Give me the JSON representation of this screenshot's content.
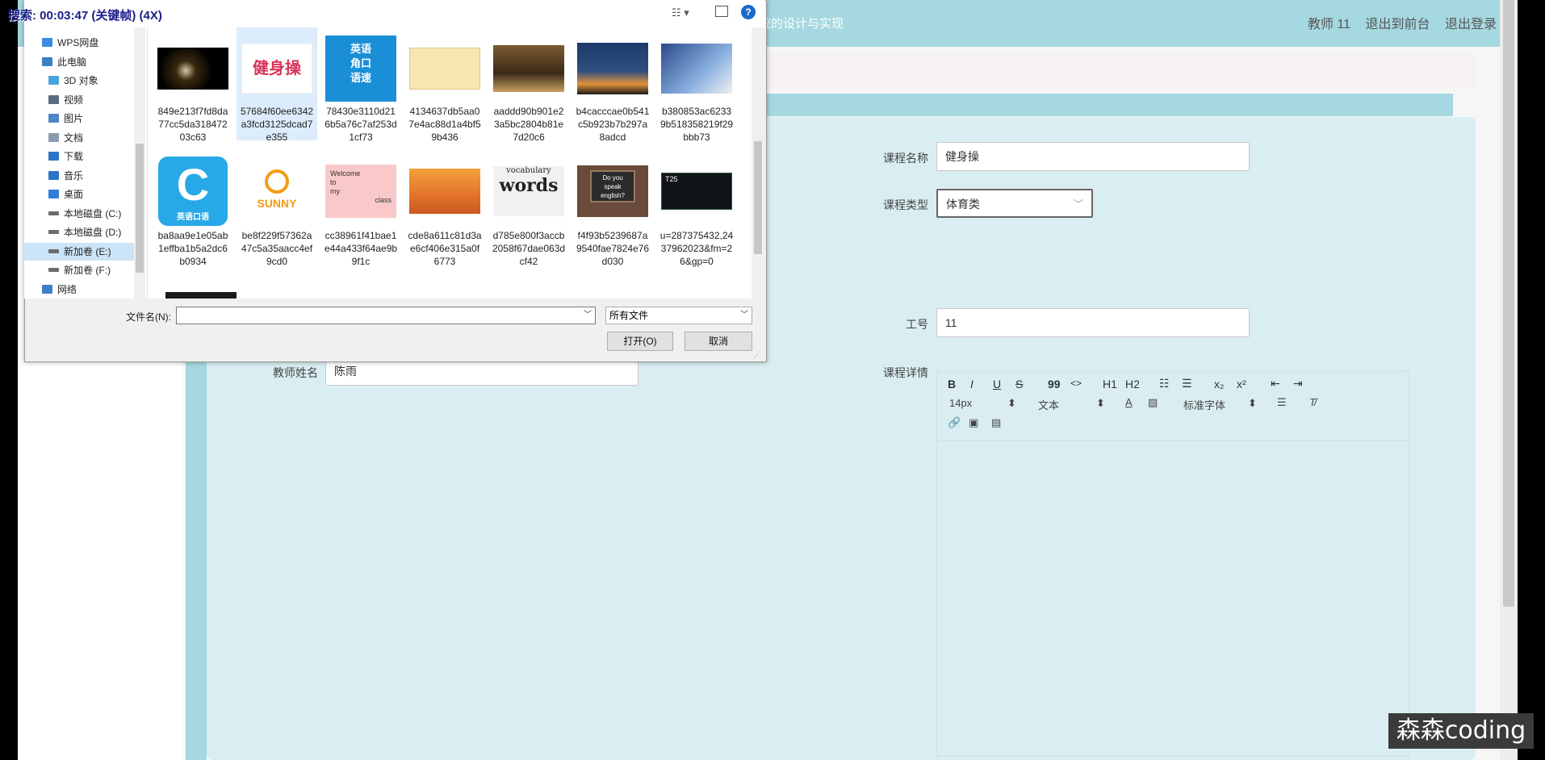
{
  "dialog": {
    "caption": "搜索: 00:03:47 (关键帧) (4X)",
    "tree": [
      {
        "label": "WPS网盘",
        "icon": "cloud-icon",
        "indent": 0
      },
      {
        "label": "此电脑",
        "icon": "computer-icon",
        "indent": 0
      },
      {
        "label": "3D 对象",
        "icon": "cube-icon",
        "indent": 1
      },
      {
        "label": "视频",
        "icon": "video-icon",
        "indent": 1
      },
      {
        "label": "图片",
        "icon": "picture-icon",
        "indent": 1
      },
      {
        "label": "文档",
        "icon": "document-icon",
        "indent": 1
      },
      {
        "label": "下载",
        "icon": "download-icon",
        "indent": 1
      },
      {
        "label": "音乐",
        "icon": "music-icon",
        "indent": 1
      },
      {
        "label": "桌面",
        "icon": "desktop-icon",
        "indent": 1
      },
      {
        "label": "本地磁盘 (C:)",
        "icon": "drive-icon",
        "indent": 1
      },
      {
        "label": "本地磁盘 (D:)",
        "icon": "drive-icon",
        "indent": 1
      },
      {
        "label": "新加卷 (E:)",
        "icon": "drive-icon",
        "indent": 1,
        "selected": true
      },
      {
        "label": "新加卷 (F:)",
        "icon": "drive-icon",
        "indent": 1
      },
      {
        "label": "网络",
        "icon": "network-icon",
        "indent": 0
      }
    ],
    "files": [
      {
        "name": "849e213f7fd8da77cc5da31847203c63",
        "thumb": "dark-dancer"
      },
      {
        "name": "57684f60ee6342a3fcd3125dcad7e355",
        "thumb": "fitness-logo",
        "selected": true
      },
      {
        "name": "78430e3110d216b5a76c7af253d1cf73",
        "thumb": "english-corner"
      },
      {
        "name": "4134637db5aa07e4ac88d1a4bf59b436",
        "thumb": "text-card"
      },
      {
        "name": "aaddd90b901e23a5bc2804b81e7d20c6",
        "thumb": "crowd-photo"
      },
      {
        "name": "b4cacccae0b541c5b923b7b297a8adcd",
        "thumb": "sunset-photo"
      },
      {
        "name": "b380853ac62339b518358219f29bbb73",
        "thumb": "business-photo"
      },
      {
        "name": "ba8aa9e1e05ab1effba1b5a2dc6b0934",
        "thumb": "english-app-logo"
      },
      {
        "name": "be8f229f57362a47c5a35aacc4ef9cd0",
        "thumb": "sunny-logo"
      },
      {
        "name": "cc38961f41bae1e44a433f64ae9b9f1c",
        "thumb": "welcome-card"
      },
      {
        "name": "cde8a611c81d3ae6cf406e315a0f6773",
        "thumb": "jump-photo"
      },
      {
        "name": "d785e800f3accb2058f67dae063dcf42",
        "thumb": "vocabulary-words"
      },
      {
        "name": "f4f93b5239687a9540fae7824e76d030",
        "thumb": "speak-english"
      },
      {
        "name": "u=287375432,2437962023&fm=26&gp=0",
        "thumb": "t25-screen"
      }
    ],
    "thumb_text": {
      "fitness": "健身操",
      "english_corner_1": "英语",
      "english_corner_2": "角口",
      "english_corner_3": "语速",
      "english_app": "英语口语",
      "sunny": "SUNNY",
      "welcome_1": "Welcome",
      "welcome_2": "to",
      "welcome_3": "my",
      "welcome_4": "class",
      "vocab_1": "vocabulary",
      "vocab_2": "words",
      "speak_1": "Do you",
      "speak_2": "speak",
      "speak_3": "english?",
      "t25": "T25"
    },
    "filename_label": "文件名(N):",
    "filename_value": "",
    "filetype": "所有文件",
    "open_button": "打开(O)",
    "cancel_button": "取消"
  },
  "page": {
    "system_title": "统的设计与实现",
    "user": "教师 11",
    "back_front": "退出到前台",
    "logout": "退出登录",
    "form": {
      "course_name_label": "课程名称",
      "course_name_value": "健身操",
      "course_type_label": "课程类型",
      "course_type_value": "体育类",
      "job_no_label": "工号",
      "job_no_value": "11",
      "teacher_name_label": "教师姓名",
      "teacher_name_value": "陈雨",
      "detail_label": "课程详情"
    },
    "editor": {
      "font_size": "14px",
      "paragraph": "文本",
      "font_family": "标准字体",
      "buttons_row1": [
        "B",
        "I",
        "U",
        "S",
        "99",
        "<>",
        "H1",
        "H2"
      ],
      "list_buttons": [
        "☷",
        "☰"
      ],
      "script_buttons": [
        "x₂",
        "x²"
      ]
    }
  },
  "watermark": "森森coding",
  "colors": {
    "teal": "#a5d8e0",
    "panel": "#daeef2",
    "selection": "#dcecfc"
  }
}
